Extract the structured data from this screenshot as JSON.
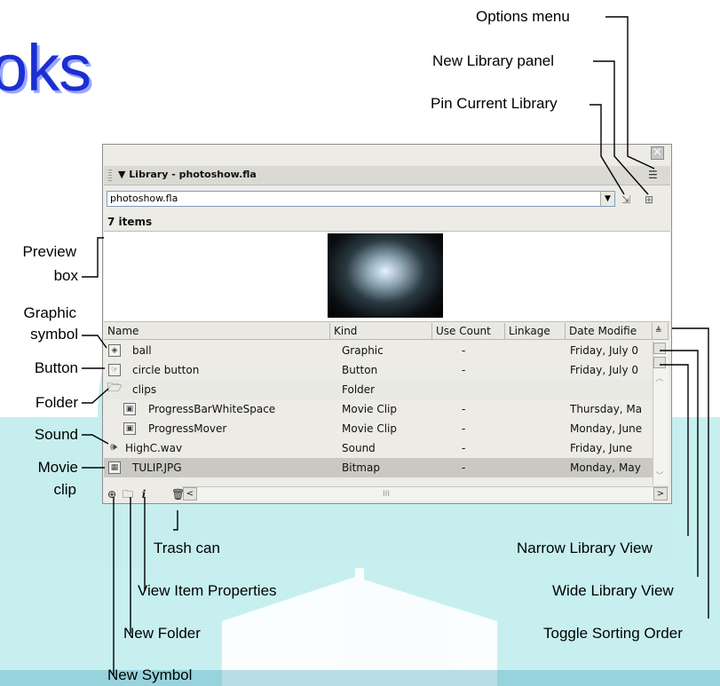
{
  "heading_fragment": "oks",
  "panel": {
    "title": "▼ Library - photoshow.fla",
    "library_select": "photoshow.fla",
    "item_count": "7 items",
    "columns": [
      "Name",
      "Kind",
      "Use Count",
      "Linkage",
      "Date Modifie"
    ],
    "rows": [
      {
        "name": "ball",
        "kind": "Graphic",
        "use_count": "-",
        "linkage": "",
        "date": "Friday, July 0",
        "icon": "graphic-symbol-icon"
      },
      {
        "name": "circle button",
        "kind": "Button",
        "use_count": "-",
        "linkage": "",
        "date": "Friday, July 0",
        "icon": "button-symbol-icon"
      },
      {
        "name": "clips",
        "kind": "Folder",
        "use_count": "",
        "linkage": "",
        "date": "",
        "icon": "folder-icon"
      },
      {
        "name": "ProgressBarWhiteSpace",
        "kind": "Movie Clip",
        "use_count": "-",
        "linkage": "",
        "date": "Thursday, Ma",
        "icon": "movie-clip-icon"
      },
      {
        "name": "ProgressMover",
        "kind": "Movie Clip",
        "use_count": "-",
        "linkage": "",
        "date": "Monday, June",
        "icon": "movie-clip-icon"
      },
      {
        "name": "HighC.wav",
        "kind": "Sound",
        "use_count": "-",
        "linkage": "",
        "date": "Friday, June",
        "icon": "sound-icon"
      },
      {
        "name": "TULIP.JPG",
        "kind": "Bitmap",
        "use_count": "-",
        "linkage": "",
        "date": "Monday, May",
        "icon": "bitmap-icon"
      }
    ],
    "scroll_mid_label": "III",
    "selected_row": 6
  },
  "callouts": {
    "options_menu": "Options menu",
    "new_library_panel": "New Library panel",
    "pin_current_library": "Pin Current Library",
    "preview_box_1": "Preview",
    "preview_box_2": "box",
    "graphic_symbol_1": "Graphic",
    "graphic_symbol_2": "symbol",
    "button": "Button",
    "folder": "Folder",
    "sound": "Sound",
    "movie_clip_1": "Movie",
    "movie_clip_2": "clip",
    "trash_can": "Trash can",
    "view_item_properties": "View Item Properties",
    "new_folder": "New Folder",
    "new_symbol": "New Symbol",
    "narrow_library_view": "Narrow Library View",
    "wide_library_view": "Wide Library View",
    "toggle_sorting_order": "Toggle Sorting Order"
  },
  "colors": {
    "heading": "#1b2fd2",
    "panel_bg": "#ecebe6",
    "selected_row": "#c9c8c2",
    "watermark": "#5fd0d3"
  }
}
